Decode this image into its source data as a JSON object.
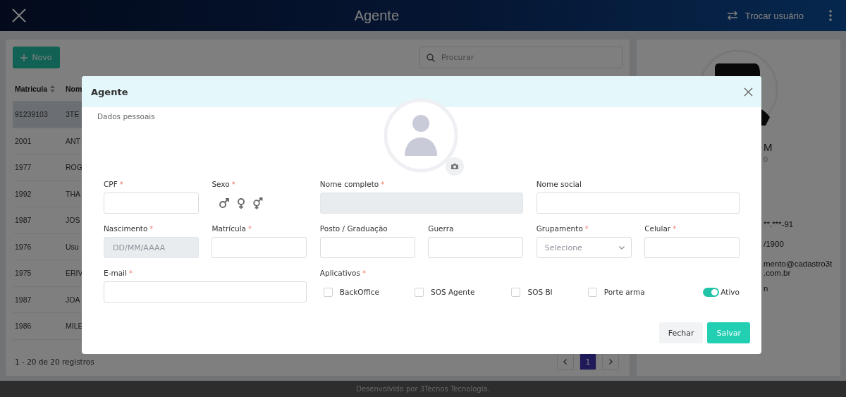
{
  "header": {
    "title": "Agente",
    "switch_user": "Trocar usuário"
  },
  "list": {
    "new_button": "Novo",
    "search_placeholder": "Procurar",
    "columns": [
      "Matricula",
      "Nom"
    ],
    "rows": [
      {
        "cells": [
          "91239103",
          "3TE"
        ],
        "selected": true
      },
      {
        "cells": [
          "2001",
          "ANT"
        ],
        "selected": false
      },
      {
        "cells": [
          "1977",
          "ROG"
        ],
        "selected": false
      },
      {
        "cells": [
          "1992",
          "THA"
        ],
        "selected": false
      },
      {
        "cells": [
          "1987",
          "JOS"
        ],
        "selected": false
      },
      {
        "cells": [
          "1976",
          "Usu"
        ],
        "selected": false
      },
      {
        "cells": [
          "1975",
          "ERIV"
        ],
        "selected": false
      },
      {
        "cells": [
          "1987",
          "JOA"
        ],
        "selected": false
      },
      {
        "cells": [
          "1986",
          "MILE"
        ],
        "selected": false
      }
    ],
    "count": "1 - 20 de 20 registros",
    "pages": [
      {
        "label": "1",
        "selected": true
      }
    ]
  },
  "profile": {
    "lines": [
      {
        "text": "M",
        "kind": "name"
      },
      {
        "text": "0",
        "kind": "sub"
      },
      {
        "text": "**.***-91",
        "kind": "detail"
      },
      {
        "text": "/1900",
        "kind": "detail"
      },
      {
        "text": "mento@cadastro3t",
        "kind": "detail"
      },
      {
        "text": ".com.br",
        "kind": "detail"
      },
      {
        "text": "n",
        "kind": "detail"
      }
    ]
  },
  "modal": {
    "title": "Agente",
    "section": "Dados pessoais",
    "fields": [
      {
        "kind": "text",
        "label": "CPF",
        "mark": "*",
        "disabled": false
      },
      {
        "kind": "sex",
        "label": "Sexo",
        "mark": "*",
        "options": [
          {
            "kind": "male",
            "selected": false
          },
          {
            "kind": "female",
            "selected": false
          },
          {
            "kind": "intersex",
            "selected": false
          }
        ]
      },
      {
        "kind": "text",
        "label": "Nome completo",
        "mark": "*",
        "disabled": true
      },
      {
        "kind": "text",
        "label": "Nome social",
        "disabled": false
      },
      {
        "kind": "text",
        "label": "Nascimento",
        "mark": "*",
        "disabled": true,
        "placeholder": "DD/MM/AAAA"
      },
      {
        "kind": "text",
        "label": "Matrícula",
        "mark": "*",
        "disabled": false
      },
      {
        "kind": "text",
        "label": "Posto / Graduação",
        "disabled": false
      },
      {
        "kind": "text",
        "label": "Guerra",
        "disabled": false
      },
      {
        "kind": "select",
        "label": "Grupamento",
        "mark": "*",
        "placeholder": "Selecione"
      },
      {
        "kind": "text",
        "label": "Celular",
        "mark": "*",
        "disabled": false
      },
      {
        "kind": "text",
        "label": "E-mail",
        "mark": "*",
        "disabled": false
      }
    ],
    "apps": {
      "label": "Aplicativos",
      "mark": "*",
      "items": [
        {
          "label": "BackOffice",
          "checked": false
        },
        {
          "label": "SOS Agente",
          "checked": false
        },
        {
          "label": "SOS BI",
          "checked": false
        },
        {
          "label": "Porte arma",
          "checked": false
        }
      ]
    },
    "active": {
      "label": "Ativo",
      "on": true
    },
    "buttons": [
      {
        "label": "Fechar",
        "kind": "secondary"
      },
      {
        "label": "Salvar",
        "kind": "primary"
      }
    ]
  },
  "footer": "Desenvolvido por 3Tecnos Tecnologia."
}
